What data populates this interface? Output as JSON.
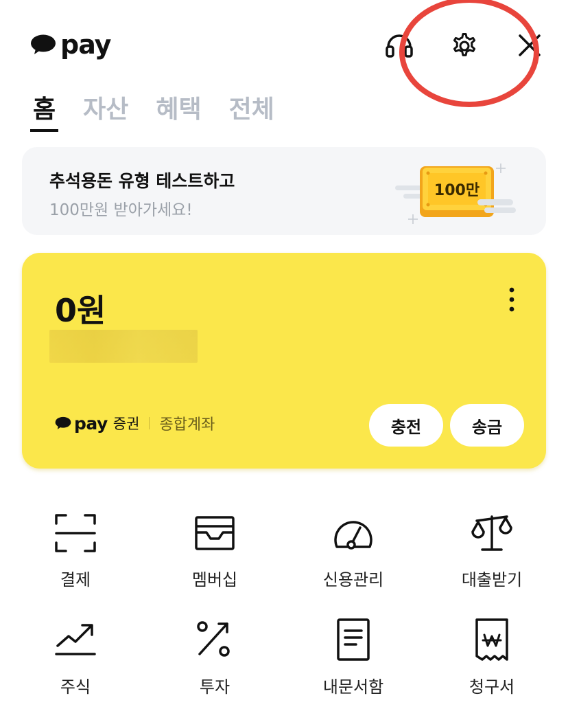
{
  "header": {
    "logo_text": "pay",
    "icons": [
      "headset-icon",
      "gear-icon",
      "close-icon"
    ]
  },
  "tabs": [
    {
      "label": "홈",
      "active": true
    },
    {
      "label": "자산",
      "active": false
    },
    {
      "label": "혜택",
      "active": false
    },
    {
      "label": "전체",
      "active": false
    }
  ],
  "promo": {
    "title": "추석용돈 유형 테스트하고",
    "subtitle": "100만원 받아가세요!",
    "badge": "100만"
  },
  "card": {
    "balance": "0원",
    "broker_logo": "pay",
    "broker_name": "증권",
    "account_type": "종합계좌",
    "charge_label": "충전",
    "send_label": "송금"
  },
  "menu": [
    {
      "label": "결제",
      "icon": "scan-icon"
    },
    {
      "label": "멤버십",
      "icon": "wallet-icon"
    },
    {
      "label": "신용관리",
      "icon": "gauge-icon"
    },
    {
      "label": "대출받기",
      "icon": "scale-icon"
    },
    {
      "label": "주식",
      "icon": "chart-up-icon"
    },
    {
      "label": "투자",
      "icon": "percent-icon"
    },
    {
      "label": "내문서함",
      "icon": "document-icon"
    },
    {
      "label": "청구서",
      "icon": "bill-icon"
    }
  ],
  "colors": {
    "accent_yellow": "#fbe74b",
    "highlight_red": "#e8453c",
    "inactive_tab": "#b6bcc6"
  }
}
